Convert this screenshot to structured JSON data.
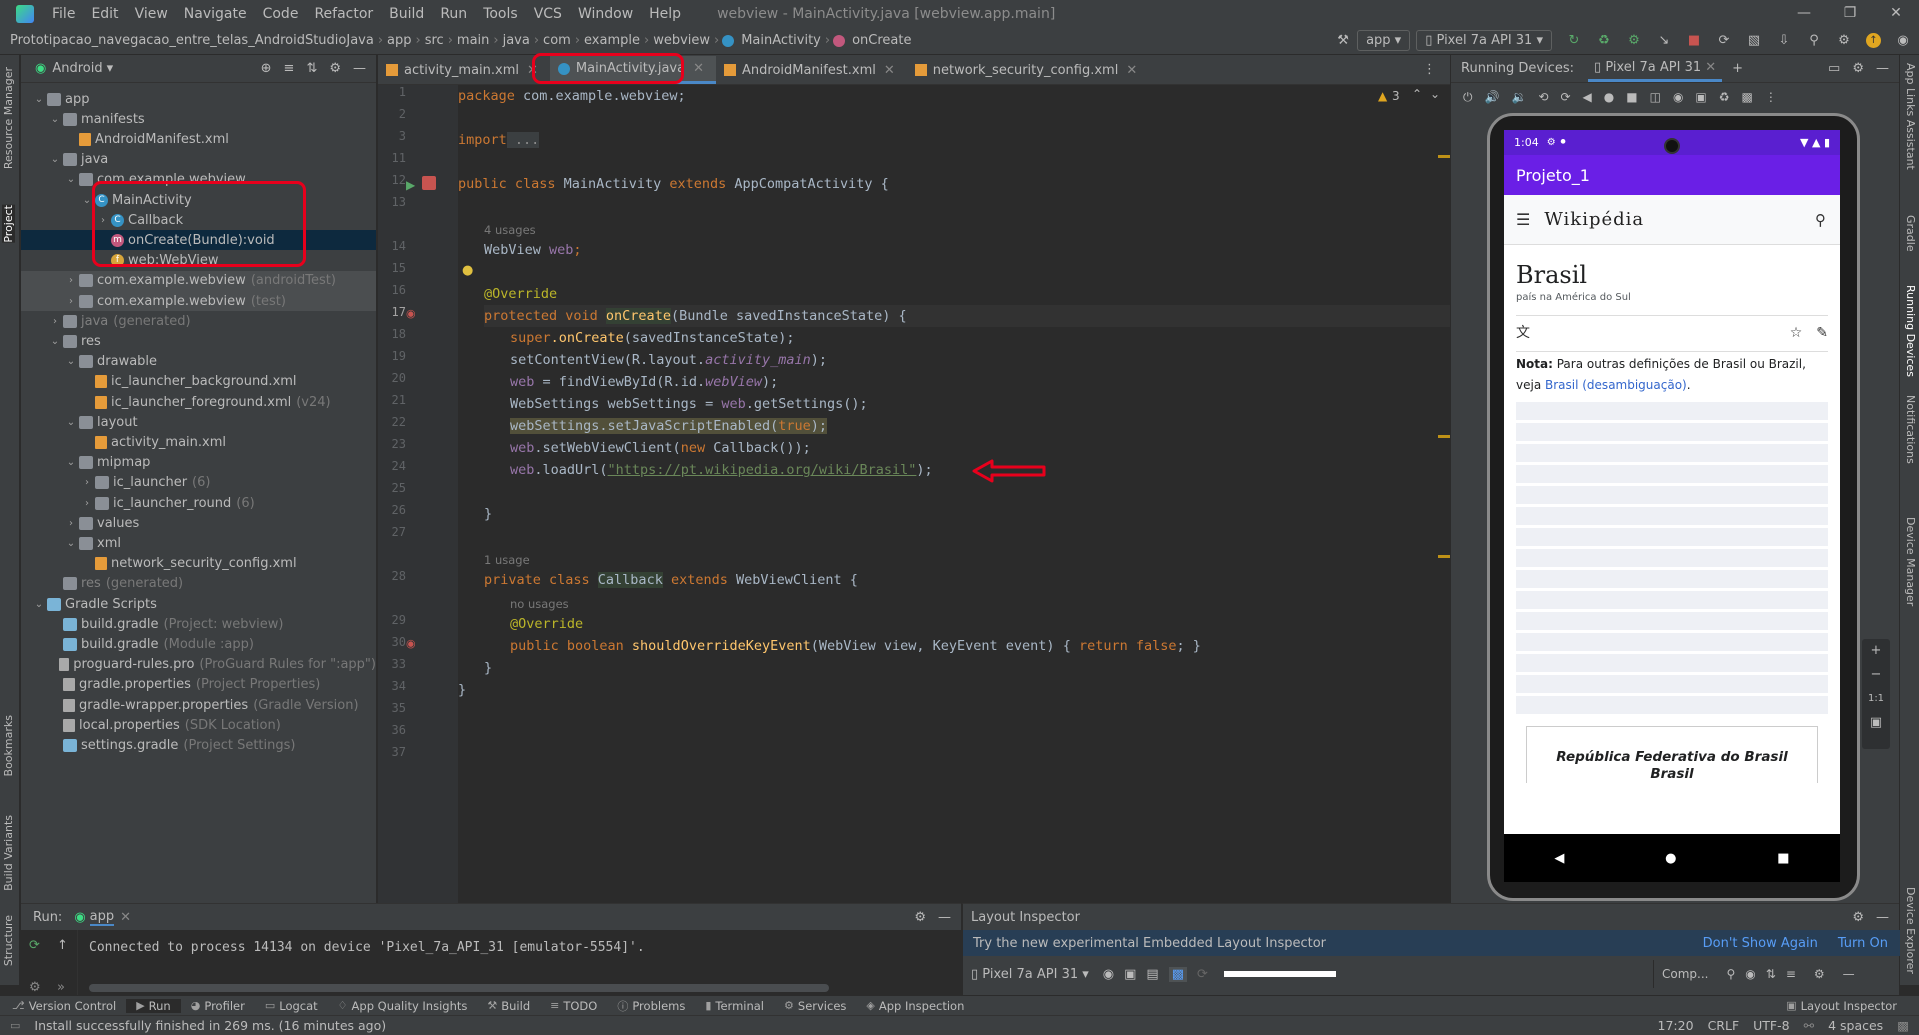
{
  "menubar": {
    "items": [
      "File",
      "Edit",
      "View",
      "Navigate",
      "Code",
      "Refactor",
      "Build",
      "Run",
      "Tools",
      "VCS",
      "Window",
      "Help"
    ],
    "window_title": "webview - MainActivity.java [webview.app.main]"
  },
  "breadcrumbs": [
    "Prototipacao_navegacao_entre_telas_AndroidStudioJava",
    "app",
    "src",
    "main",
    "java",
    "com",
    "example",
    "webview",
    "MainActivity",
    "onCreate"
  ],
  "toolbar": {
    "config": "app",
    "device": "Pixel 7a API 31"
  },
  "project_panel": {
    "view": "Android",
    "tree": [
      {
        "label": "app",
        "hint": "",
        "icon": "folder"
      },
      {
        "label": "manifests",
        "hint": "",
        "icon": "folder"
      },
      {
        "label": "AndroidManifest.xml",
        "hint": "",
        "icon": "xml"
      },
      {
        "label": "java",
        "hint": "",
        "icon": "folder"
      },
      {
        "label": "com.example.webview",
        "hint": "",
        "icon": "package"
      },
      {
        "label": "MainActivity",
        "hint": "",
        "icon": "class"
      },
      {
        "label": "Callback",
        "hint": "",
        "icon": "class"
      },
      {
        "label": "onCreate(Bundle):void",
        "hint": "",
        "icon": "method"
      },
      {
        "label": "web:WebView",
        "hint": "",
        "icon": "field"
      },
      {
        "label": "com.example.webview",
        "hint": "(androidTest)",
        "icon": "package"
      },
      {
        "label": "com.example.webview",
        "hint": "(test)",
        "icon": "package"
      },
      {
        "label": "java",
        "hint": "(generated)",
        "icon": "folder"
      },
      {
        "label": "res",
        "hint": "",
        "icon": "folder"
      },
      {
        "label": "drawable",
        "hint": "",
        "icon": "folder"
      },
      {
        "label": "ic_launcher_background.xml",
        "hint": "",
        "icon": "xml"
      },
      {
        "label": "ic_launcher_foreground.xml",
        "hint": "(v24)",
        "icon": "xml"
      },
      {
        "label": "layout",
        "hint": "",
        "icon": "folder"
      },
      {
        "label": "activity_main.xml",
        "hint": "",
        "icon": "xml"
      },
      {
        "label": "mipmap",
        "hint": "",
        "icon": "folder"
      },
      {
        "label": "ic_launcher",
        "hint": "(6)",
        "icon": "folder"
      },
      {
        "label": "ic_launcher_round",
        "hint": "(6)",
        "icon": "folder"
      },
      {
        "label": "values",
        "hint": "",
        "icon": "folder"
      },
      {
        "label": "xml",
        "hint": "",
        "icon": "folder"
      },
      {
        "label": "network_security_config.xml",
        "hint": "",
        "icon": "xml"
      },
      {
        "label": "res",
        "hint": "(generated)",
        "icon": "folder"
      },
      {
        "label": "Gradle Scripts",
        "hint": "",
        "icon": "gradle"
      },
      {
        "label": "build.gradle",
        "hint": "(Project: webview)",
        "icon": "gradle"
      },
      {
        "label": "build.gradle",
        "hint": "(Module :app)",
        "icon": "gradle"
      },
      {
        "label": "proguard-rules.pro",
        "hint": "(ProGuard Rules for \":app\")",
        "icon": "prop"
      },
      {
        "label": "gradle.properties",
        "hint": "(Project Properties)",
        "icon": "prop"
      },
      {
        "label": "gradle-wrapper.properties",
        "hint": "(Gradle Version)",
        "icon": "prop"
      },
      {
        "label": "local.properties",
        "hint": "(SDK Location)",
        "icon": "prop"
      },
      {
        "label": "settings.gradle",
        "hint": "(Project Settings)",
        "icon": "gradle"
      }
    ]
  },
  "editor_tabs": [
    "activity_main.xml",
    "MainActivity.java",
    "AndroidManifest.xml",
    "network_security_config.xml"
  ],
  "editor": {
    "warning_count": "3",
    "line_numbers": [
      "1",
      "2",
      "3",
      "11",
      "12",
      "13",
      "",
      "14",
      "15",
      "16",
      "17",
      "18",
      "19",
      "20",
      "21",
      "22",
      "23",
      "24",
      "25",
      "26",
      "27",
      "",
      "28",
      "",
      "29",
      "30",
      "33",
      "34",
      "35",
      "36",
      "37"
    ],
    "lines": {
      "package": "package",
      "package_name": " com.example.webview;",
      "import": "import",
      "import_fold": " ...",
      "class_decl_public": "public class",
      "class_decl_name": " MainActivity ",
      "class_decl_extends": "extends",
      "class_decl_base": " AppCompatActivity {",
      "usages_4": "4 usages",
      "field_type": "WebView ",
      "field_name": "web",
      "field_end": ";",
      "override1": "@Override",
      "oncreate_kw": "protected void ",
      "oncreate_name": "onCreate",
      "oncreate_params": "(Bundle savedInstanceState) {",
      "super_kw": "super",
      "super_call": ".onCreate",
      "super_rest": "(savedInstanceState);",
      "setcontent_pre": "setContentView(R.layout.",
      "setcontent_field": "activity_main",
      "setcontent_post": ");",
      "findview_field": "web",
      "findview_mid": " = findViewById(R.id.",
      "findview_id": "webView",
      "findview_post": ");",
      "settings_pre": "WebSettings webSettings = ",
      "settings_field": "web",
      "settings_post": ".getSettings();",
      "js_pre": "webSettings.setJavaScriptEnabled(",
      "js_true": "true",
      "js_post": ");",
      "client_field": "web",
      "client_mid": ".setWebViewClient(",
      "client_new": "new",
      "client_post": " Callback());",
      "load_field": "web",
      "load_mid": ".loadUrl(",
      "load_url": "\"https://pt.wikipedia.org/wiki/Brasil\"",
      "load_post": ");",
      "close_brace": "}",
      "usages_1": "1 usage",
      "private_kw": "private class ",
      "callback_name": "Callback",
      "callback_extends": " extends ",
      "callback_base": "WebViewClient {",
      "no_usages": "no usages",
      "override2": "@Override",
      "override_kw": "public boolean ",
      "override_name": "shouldOverrideKeyEvent",
      "override_params": "(WebView view, KeyEvent event) { ",
      "return_kw": "return false",
      "override_end": "; }",
      "inner_close": "}",
      "outer_close": "}"
    }
  },
  "running_devices": {
    "title": "Running Devices:",
    "device_tab": "Pixel 7a API 31",
    "phone": {
      "time": "1:04",
      "app_title": "Projeto_1",
      "wiki_logo": "Wikipédia",
      "article_title": "Brasil",
      "article_subtitle": "país na América do Sul",
      "note_label": "Nota:",
      "note_text": " Para outras definições de Brasil ou Brazil, veja ",
      "note_link": "Brasil (desambiguação)",
      "note_end": ".",
      "infobox_title": "República Federativa do Brasil",
      "infobox_sub": "Brasil"
    }
  },
  "run_panel": {
    "label": "Run:",
    "config": "app",
    "output": "Connected to process 14134 on device 'Pixel_7a_API_31 [emulator-5554]'."
  },
  "layout_inspector": {
    "title": "Layout Inspector",
    "banner": "Try the new experimental Embedded Layout Inspector",
    "dont_show": "Don't Show Again",
    "turn_on": "Turn On",
    "device": "Pixel 7a API 31",
    "comp": "Comp..."
  },
  "tool_windows": [
    "Version Control",
    "Run",
    "Profiler",
    "Logcat",
    "App Quality Insights",
    "Build",
    "TODO",
    "Problems",
    "Terminal",
    "Services",
    "App Inspection"
  ],
  "tool_window_right": "Layout Inspector",
  "status": {
    "message": "Install successfully finished in 269 ms. (16 minutes ago)",
    "position": "17:20",
    "line_sep": "CRLF",
    "encoding": "UTF-8",
    "indent": "4 spaces"
  },
  "side_tabs_left": [
    "Resource Manager",
    "Project",
    "Bookmarks",
    "Build Variants",
    "Structure"
  ],
  "side_tabs_right": [
    "App Links Assistant",
    "Gradle",
    "Running Devices",
    "Notifications",
    "Device Manager",
    "Device Explorer"
  ],
  "colors": {
    "accent_red": "#e8001c",
    "app_purple": "#6a1fe6",
    "link_blue": "#3366cc"
  }
}
